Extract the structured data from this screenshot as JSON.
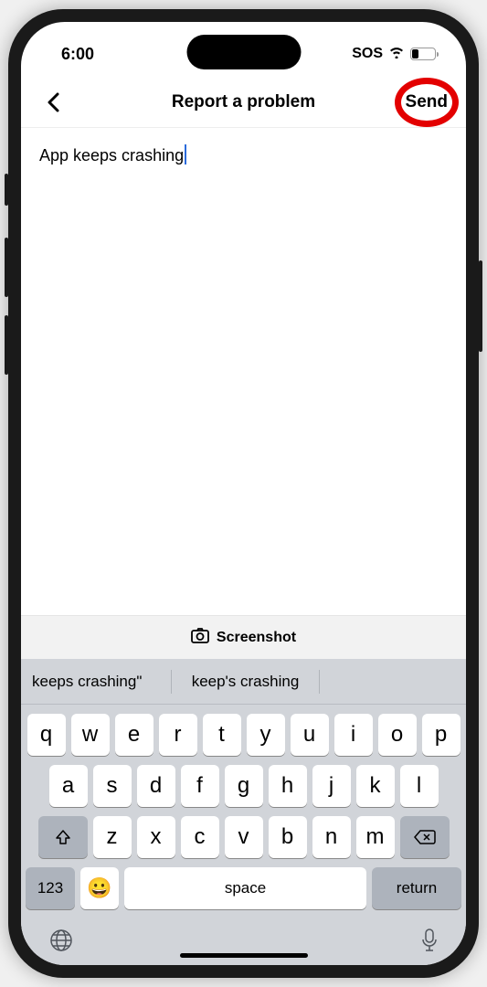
{
  "status": {
    "time": "6:00",
    "sos": "SOS",
    "battery": "27"
  },
  "nav": {
    "title": "Report a problem",
    "send": "Send"
  },
  "content": {
    "text": "App keeps crashing"
  },
  "screenshot": {
    "label": "Screenshot"
  },
  "suggestions": [
    "keeps crashing\"",
    "keep's crashing"
  ],
  "keyboard": {
    "row1": [
      "q",
      "w",
      "e",
      "r",
      "t",
      "y",
      "u",
      "i",
      "o",
      "p"
    ],
    "row2": [
      "a",
      "s",
      "d",
      "f",
      "g",
      "h",
      "j",
      "k",
      "l"
    ],
    "row3": [
      "z",
      "x",
      "c",
      "v",
      "b",
      "n",
      "m"
    ],
    "numbers": "123",
    "space": "space",
    "return": "return"
  }
}
